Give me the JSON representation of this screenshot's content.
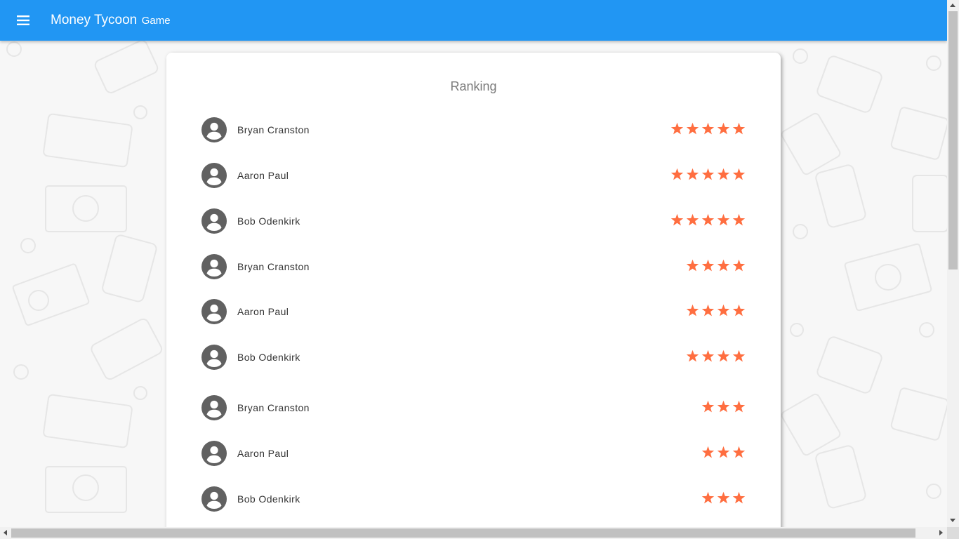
{
  "appbar": {
    "title_main": "Money Tycoon",
    "title_sub": "Game",
    "menu_icon": "hamburger-menu-icon",
    "background_color": "#2196f3"
  },
  "ranking": {
    "title": "Ranking",
    "star_color": "#ff6e40",
    "avatar_color": "#616161",
    "players": [
      {
        "name": "Bryan Cranston",
        "stars": 5
      },
      {
        "name": "Aaron Paul",
        "stars": 5
      },
      {
        "name": "Bob Odenkirk",
        "stars": 5
      },
      {
        "name": "Bryan Cranston",
        "stars": 4
      },
      {
        "name": "Aaron Paul",
        "stars": 4
      },
      {
        "name": "Bob Odenkirk",
        "stars": 4
      },
      {
        "name": "Bryan Cranston",
        "stars": 3
      },
      {
        "name": "Aaron Paul",
        "stars": 3
      },
      {
        "name": "Bob Odenkirk",
        "stars": 3
      }
    ]
  }
}
